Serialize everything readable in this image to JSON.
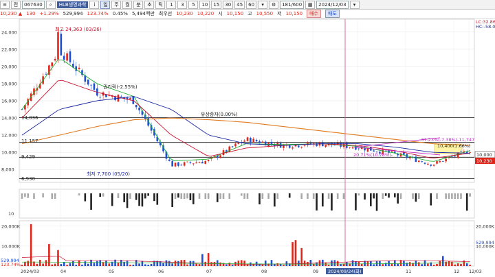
{
  "toolbar": {
    "stock_code": "067630",
    "stock_name": "HLB생명과학",
    "period_buttons": [
      "일",
      "주",
      "월",
      "분",
      "초",
      "틱"
    ],
    "interval_buttons": [
      "1",
      "3",
      "5",
      "10",
      "15",
      "30",
      "45",
      "60"
    ],
    "page_count": "181/600",
    "date": "2024/12/03"
  },
  "quote": {
    "price": "10,230",
    "change": "130",
    "change_pct": "+1.29%",
    "volume": "529,994",
    "volume_ratio": "123.74%",
    "turnover_pct": "0.45%",
    "amount": "5,494백만",
    "open_label": "최우선",
    "best_price": "10,230",
    "best_price2": "10,220",
    "open_lbl": "시",
    "open": "10,150",
    "high_lbl": "고",
    "high": "10,550",
    "low_lbl": "저",
    "low": "10,150",
    "buy_label": "매수",
    "sell_label": "매도"
  },
  "chart": {
    "price_ticks": [
      "24,000",
      "22,000",
      "20,000",
      "18,000",
      "16,000",
      "14,000",
      "12,000",
      "10,000",
      "8,000"
    ],
    "right_top_labels": [
      "LC:32.86",
      "HC:-58.0"
    ],
    "right_price_label": "10,000",
    "right_current_label": "10,230",
    "levels": [
      "14,036",
      "11,157",
      "9,429",
      "6,930"
    ],
    "annotations": {
      "high": "최고 24,363 (03/26)",
      "low": "최저 7,700 (05/20)",
      "rights": "권리락(-2.55%)",
      "capital_increase": "유상증자(0.00%)",
      "fib_top": "-37.23%(-7.38%)-11,747",
      "fib_mid": "20.71%(10.78%)-",
      "current_tag": "10,400(1.66%)"
    },
    "osc_ticks": [
      "10"
    ],
    "volume_ticks": [
      "20,000K",
      "10,000K"
    ],
    "volume_right_labels": [
      "20,000K",
      "10,000K"
    ],
    "volume_current": "529,994",
    "volume_pct": "123.74%",
    "x_labels": [
      "2024/03",
      "04",
      "05",
      "06",
      "07",
      "08",
      "09",
      "10",
      "11",
      "12",
      "12/03"
    ],
    "cursor_date": "2024/09/24(화)"
  },
  "chart_data": {
    "type": "candlestick",
    "title": "",
    "ylim": [
      6500,
      25500
    ],
    "x": [
      "2024/03",
      "04",
      "05",
      "06",
      "07",
      "08",
      "09",
      "10",
      "11",
      "12"
    ],
    "close": [
      15000,
      22000,
      17000,
      16000,
      8500,
      9000,
      11500,
      10800,
      11000,
      10600,
      9800,
      8600,
      10230
    ],
    "levels": [
      14036,
      11157,
      9429,
      6930
    ],
    "series": [
      {
        "name": "ma5",
        "values": [
          15000,
          21000,
          18000,
          16500,
          9000,
          9200,
          11000,
          10900,
          11000,
          10700,
          9900,
          8900,
          10200
        ]
      },
      {
        "name": "ma20",
        "values": [
          14000,
          18500,
          17000,
          16000,
          12000,
          9500,
          10500,
          10800,
          11000,
          10800,
          10200,
          9300,
          9900
        ]
      },
      {
        "name": "ma60",
        "values": [
          12000,
          15000,
          16000,
          16500,
          15000,
          12000,
          11000,
          10800,
          11000,
          11000,
          10600,
          10000,
          9900
        ]
      },
      {
        "name": "ma120",
        "values": [
          11000,
          12000,
          13000,
          13800,
          14000,
          13800,
          13500,
          13000,
          12500,
          12000,
          11500,
          11000,
          10800
        ]
      }
    ],
    "volume_max_k": 22000
  },
  "colors": {
    "up": "#e0251b",
    "down": "#1f4fd0",
    "ma5": "#1fae32",
    "ma20": "#c8102e",
    "ma60": "#1c2aa0",
    "ma120": "#e07a20",
    "fib": "#c020c0",
    "cursor": "#d24a8a"
  }
}
